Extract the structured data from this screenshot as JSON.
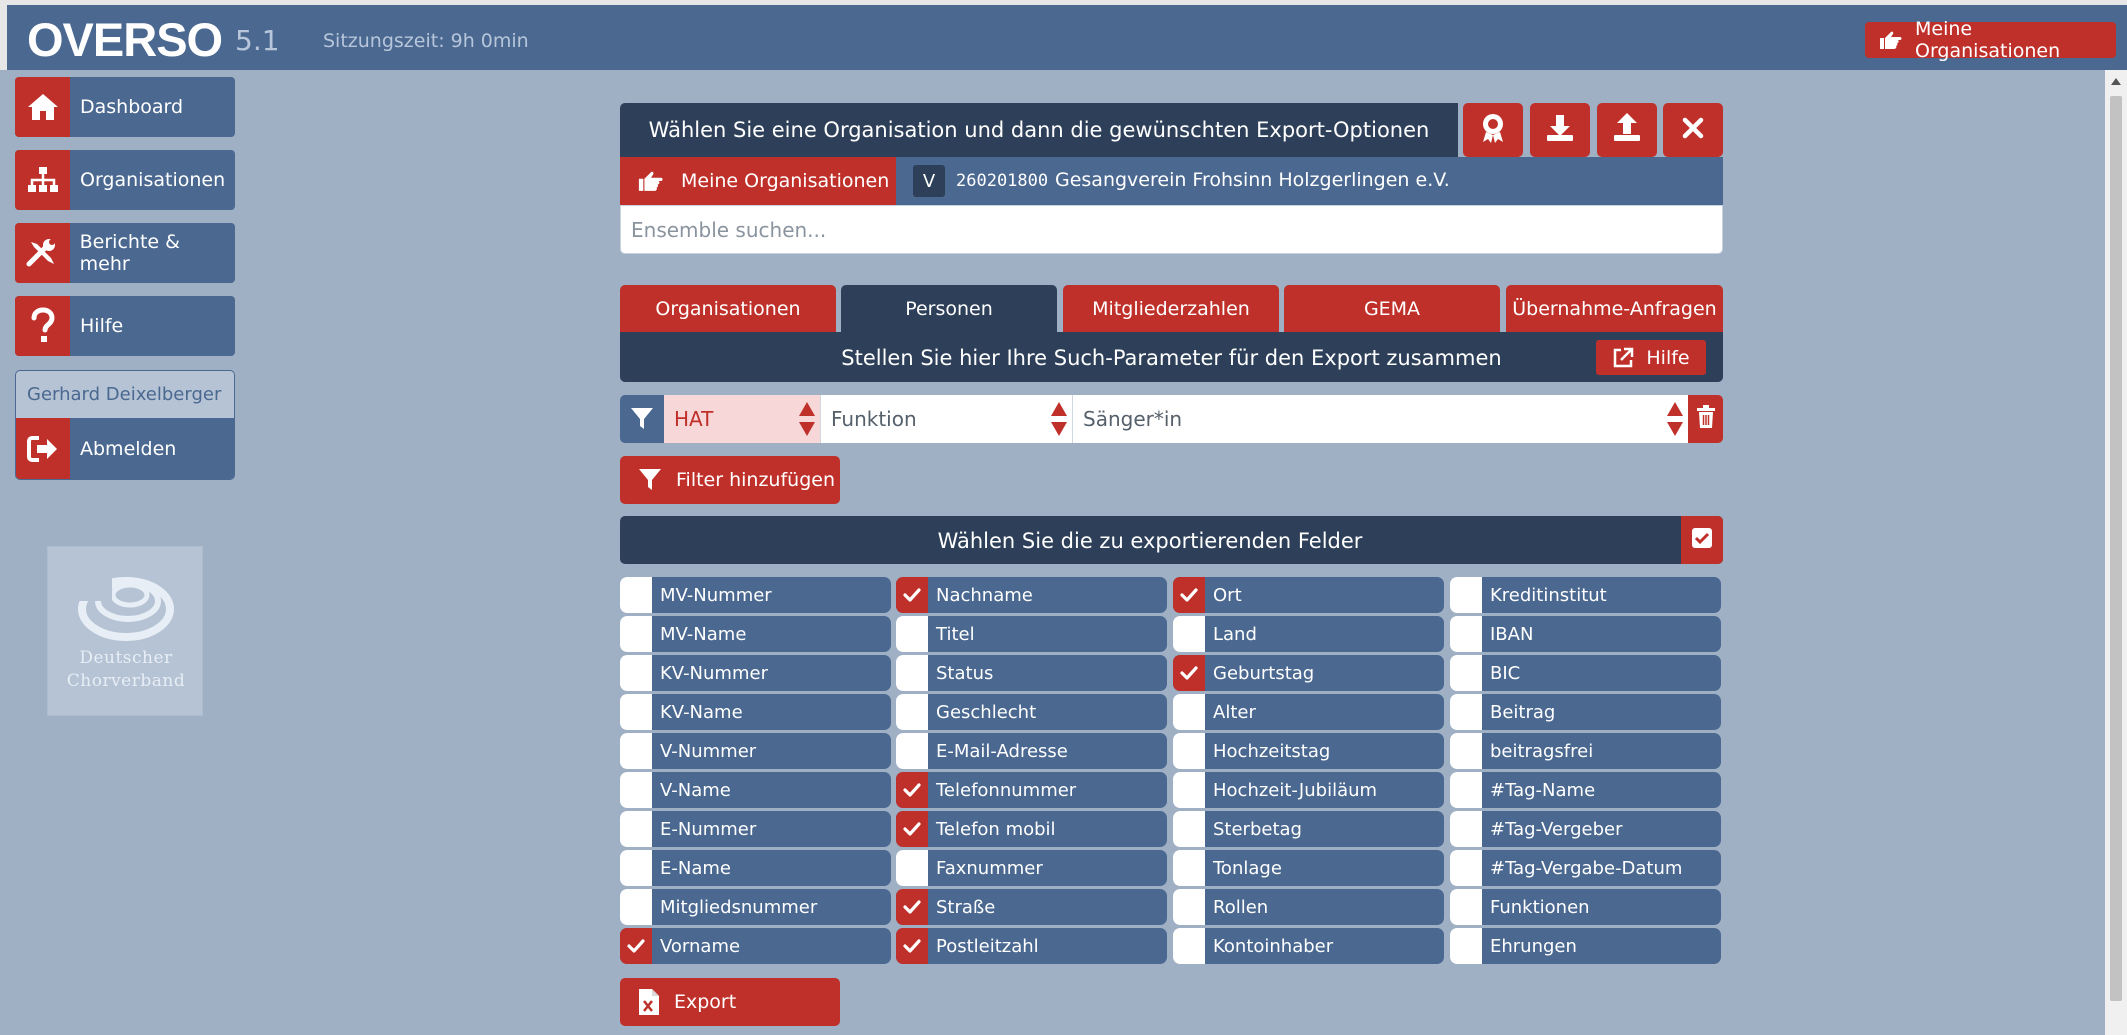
{
  "app": {
    "logo": "OVERSO",
    "version": "5.1",
    "session": "Sitzungszeit: 9h 0min",
    "top_button": "Meine Organisationen"
  },
  "sidebar": {
    "items": [
      {
        "label": "Dashboard",
        "icon": "home-icon"
      },
      {
        "label": "Organisationen",
        "icon": "sitemap-icon"
      },
      {
        "label": "Berichte & mehr",
        "icon": "tools-icon"
      },
      {
        "label": "Hilfe",
        "icon": "question-icon"
      }
    ],
    "user": "Gerhard Deixelberger",
    "logout": "Abmelden",
    "logo_line1": "Deutscher",
    "logo_line2": "Chorverband"
  },
  "main": {
    "header_title": "Wählen Sie eine Organisation und dann die gewünschten Export-Optionen",
    "header_buttons": [
      "award-icon",
      "download-icon",
      "upload-icon",
      "close-icon"
    ],
    "org_button": "Meine Organisationen",
    "org_badge": "V",
    "org_number": "260201800",
    "org_name": "Gesangverein Frohsinn Holzgerlingen e.V.",
    "search_placeholder": "Ensemble suchen...",
    "tabs": [
      "Organisationen",
      "Personen",
      "Mitgliederzahlen",
      "GEMA",
      "Übernahme-Anfragen"
    ],
    "active_tab": "Personen",
    "params_text": "Stellen Sie hier Ihre Such-Parameter für den Export zusammen",
    "help_button": "Hilfe",
    "filter": {
      "mode": "HAT",
      "field": "Funktion",
      "value": "Sänger*in"
    },
    "add_filter": "Filter hinzufügen",
    "fields_title": "Wählen Sie die zu exportierenden Felder",
    "fields": [
      [
        {
          "label": "MV-Nummer",
          "checked": false
        },
        {
          "label": "MV-Name",
          "checked": false
        },
        {
          "label": "KV-Nummer",
          "checked": false
        },
        {
          "label": "KV-Name",
          "checked": false
        },
        {
          "label": "V-Nummer",
          "checked": false
        },
        {
          "label": "V-Name",
          "checked": false
        },
        {
          "label": "E-Nummer",
          "checked": false
        },
        {
          "label": "E-Name",
          "checked": false
        },
        {
          "label": "Mitgliedsnummer",
          "checked": false
        },
        {
          "label": "Vorname",
          "checked": true
        }
      ],
      [
        {
          "label": "Nachname",
          "checked": true
        },
        {
          "label": "Titel",
          "checked": false
        },
        {
          "label": "Status",
          "checked": false
        },
        {
          "label": "Geschlecht",
          "checked": false
        },
        {
          "label": "E-Mail-Adresse",
          "checked": false
        },
        {
          "label": "Telefonnummer",
          "checked": true
        },
        {
          "label": "Telefon mobil",
          "checked": true
        },
        {
          "label": "Faxnummer",
          "checked": false
        },
        {
          "label": "Straße",
          "checked": true
        },
        {
          "label": "Postleitzahl",
          "checked": true
        }
      ],
      [
        {
          "label": "Ort",
          "checked": true
        },
        {
          "label": "Land",
          "checked": false
        },
        {
          "label": "Geburtstag",
          "checked": true
        },
        {
          "label": "Alter",
          "checked": false
        },
        {
          "label": "Hochzeitstag",
          "checked": false
        },
        {
          "label": "Hochzeit-Jubiläum",
          "checked": false
        },
        {
          "label": "Sterbetag",
          "checked": false
        },
        {
          "label": "Tonlage",
          "checked": false
        },
        {
          "label": "Rollen",
          "checked": false
        },
        {
          "label": "Kontoinhaber",
          "checked": false
        }
      ],
      [
        {
          "label": "Kreditinstitut",
          "checked": false
        },
        {
          "label": "IBAN",
          "checked": false
        },
        {
          "label": "BIC",
          "checked": false
        },
        {
          "label": "Beitrag",
          "checked": false
        },
        {
          "label": "beitragsfrei",
          "checked": false
        },
        {
          "label": "#Tag-Name",
          "checked": false
        },
        {
          "label": "#Tag-Vergeber",
          "checked": false
        },
        {
          "label": "#Tag-Vergabe-Datum",
          "checked": false
        },
        {
          "label": "Funktionen",
          "checked": false
        },
        {
          "label": "Ehrungen",
          "checked": false
        }
      ]
    ],
    "export_button": "Export"
  },
  "colors": {
    "topbar": "#4a6890",
    "background": "#9fb0c5",
    "accent_red": "#c0302a",
    "dark_panel": "#2e4059"
  }
}
